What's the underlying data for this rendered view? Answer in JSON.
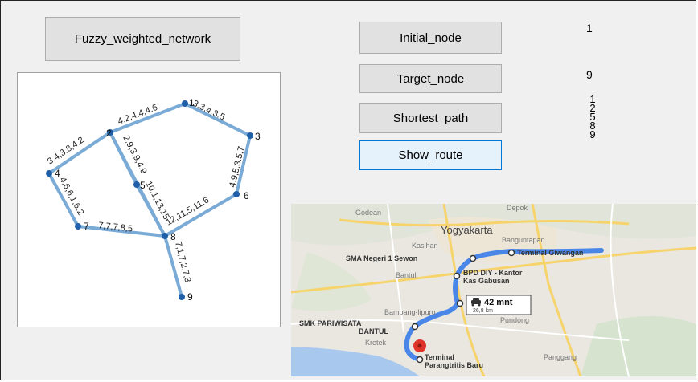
{
  "buttons": {
    "fuzzy_network": "Fuzzy_weighted_network",
    "initial_node": "Initial_node",
    "target_node": "Target_node",
    "shortest_path": "Shortest_path",
    "show_route": "Show_route"
  },
  "values": {
    "initial_node": "1",
    "target_node": "9",
    "shortest_path": [
      "1",
      "2",
      "5",
      "8",
      "9"
    ]
  },
  "graph": {
    "nodes": [
      "1",
      "2",
      "3",
      "4",
      "5",
      "6",
      "7",
      "8",
      "9"
    ],
    "edge_weights": {
      "e12": "4.2,4.4,4.6",
      "e13": "3.3,4,3.5",
      "e24": "3.4,3.8,4.2",
      "e25": "2.9,3.9,4.9",
      "e36": "4.9,5,3.5,7",
      "e47": "4,6,6,1,6.2",
      "e58": "10.1,13,15",
      "e68": "12,11,5,11.6",
      "e78": "7,7,7,8,5",
      "e89": "7,1,7,2,7,3"
    },
    "edge_color": "#7aaad6",
    "node_color": "#1f5fa8"
  },
  "map": {
    "labels": {
      "godean": "Godean",
      "depok": "Depok",
      "yogyakarta": "Yogyakarta",
      "banguntapan": "Banguntapan",
      "kasihan": "Kasihan",
      "bantul": "Bantul",
      "bambanglipuro": "Bambang-lipuro",
      "kretek": "Kretek",
      "pundong": "Pundong",
      "panggang": "Panggang"
    },
    "places": {
      "sma": "SMA Negeri 1 Sewon",
      "giwangan": "Terminal Giwangan",
      "bpd_line1": "BPD DIY - Kantor",
      "bpd_line2": "Kas Gabusan",
      "smk_line1": "SMK PARIWISATA",
      "smk_line2": "BANTUL",
      "terminal_line1": "Terminal",
      "terminal_line2": "Parangtritis Baru"
    },
    "route_time": "42 mnt",
    "route_distance": "26,8 km",
    "route_color": "#4a86e8",
    "water_color": "#a8c8ee"
  }
}
